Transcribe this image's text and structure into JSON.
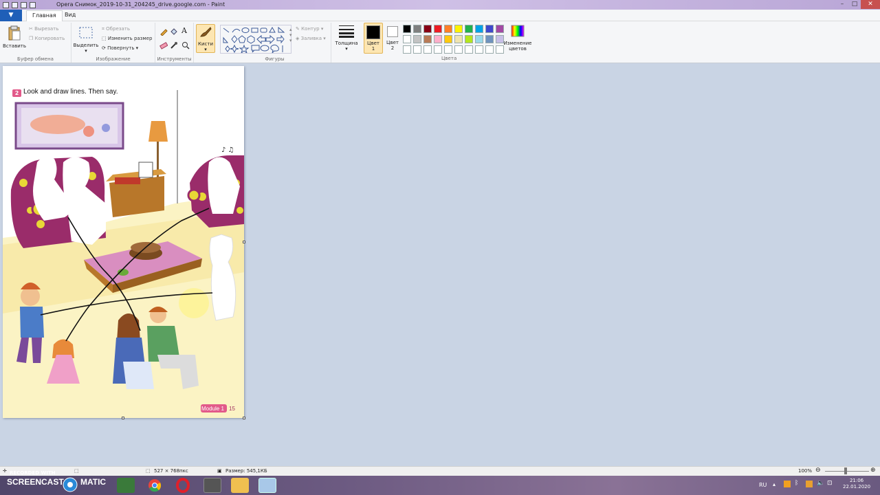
{
  "window": {
    "title": "Opera Снимок_2019-10-31_204245_drive.google.com - Paint"
  },
  "menu": {
    "file": "▼",
    "tabs": [
      "Главная",
      "Вид"
    ]
  },
  "ribbon": {
    "clipboard": {
      "paste": "Вставить",
      "cut": "Вырезать",
      "copy": "Копировать",
      "label": "Буфер обмена"
    },
    "image": {
      "select": "Выделить",
      "crop": "Обрезать",
      "resize": "Изменить размер",
      "rotate": "Повернуть",
      "label": "Изображение"
    },
    "tools": {
      "label": "Инструменты",
      "text": "A"
    },
    "brushes": {
      "label": "Кисти"
    },
    "shapes": {
      "outline": "Контур",
      "fill": "Заливка",
      "label": "Фигуры"
    },
    "size": {
      "label": "Толщина"
    },
    "color1": {
      "label": "Цвет",
      "num": "1",
      "value": "#000000"
    },
    "color2": {
      "label": "Цвет",
      "num": "2",
      "value": "#ffffff"
    },
    "colors": {
      "label": "Цвета",
      "edit_label": "Изменение",
      "edit_label2": "цветов"
    },
    "palette": [
      "#000000",
      "#7f7f7f",
      "#880015",
      "#ed1c24",
      "#ff7f27",
      "#fff200",
      "#22b14c",
      "#00a2e8",
      "#3f48cc",
      "#a349a4",
      "#ffffff",
      "#c3c3c3",
      "#b97a57",
      "#ffaec9",
      "#ffc90e",
      "#efe4b0",
      "#b5e61d",
      "#99d9ea",
      "#7092be",
      "#c8bfe7",
      "#ffffff",
      "#ffffff",
      "#ffffff",
      "#ffffff",
      "#ffffff",
      "#ffffff",
      "#ffffff",
      "#ffffff",
      "#ffffff",
      "#ffffff"
    ]
  },
  "worksheet": {
    "number": "2",
    "instruction": "Look and draw lines. Then say.",
    "module": "Module 1",
    "page": "15"
  },
  "status": {
    "dimensions": "527 × 768пкс",
    "size": "Размер: 545,1КБ",
    "zoom": "100%"
  },
  "taskbar": {
    "watermark_top": "RECORDED WITH",
    "watermark_main": "SCREENCAST",
    "watermark_tail": "MATIC",
    "lang": "RU",
    "time": "21:06",
    "date": "22.01.2020"
  }
}
